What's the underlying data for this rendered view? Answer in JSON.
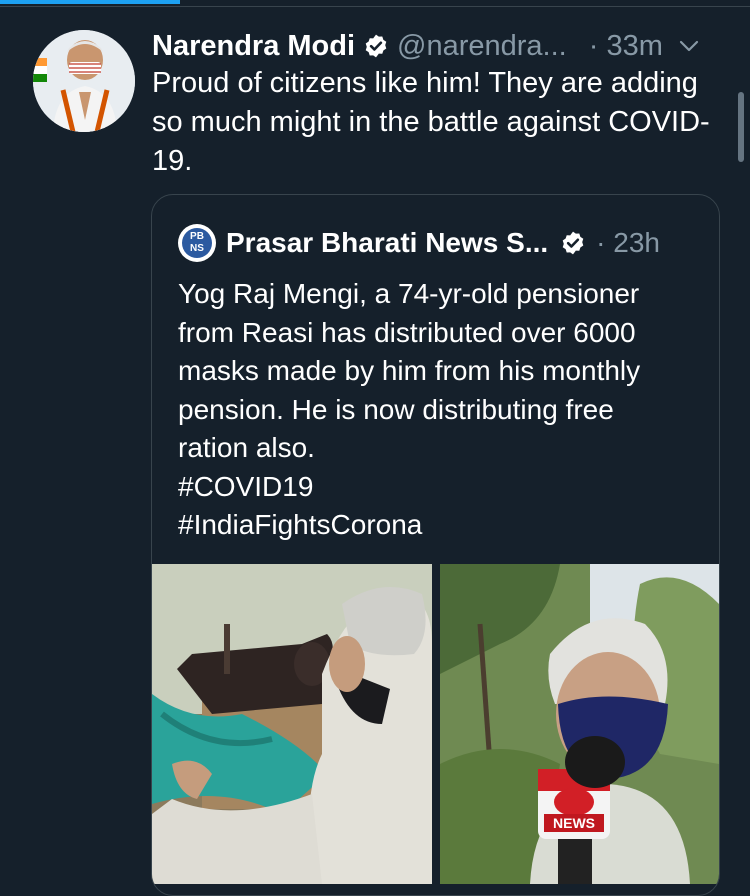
{
  "progress": {
    "value_percent": 24
  },
  "tweet": {
    "author_name": "Narendra Modi",
    "handle": "@narendra...",
    "time": "· 33m",
    "text": "Proud of citizens like him! They are adding so much might in the battle against COVID-19."
  },
  "quote": {
    "logo_text": "PB NS",
    "author_name": "Prasar Bharati News S...",
    "time": "· 23h",
    "text_lines": [
      "Yog Raj Mengi, a 74-yr-old pensioner",
      "from Reasi has distributed over 6000",
      "masks made by him from his monthly",
      "pension. He is now distributing free",
      "ration also.",
      "#COVID19",
      "#IndiaFightsCorona"
    ],
    "news_mic_label": "NEWS"
  },
  "icons": {
    "verified": "verified-badge-icon",
    "caret": "chevron-down-icon"
  },
  "colors": {
    "background": "#15202b",
    "accent": "#1da1f2",
    "secondary_text": "#8899a6",
    "border": "#38444d"
  }
}
